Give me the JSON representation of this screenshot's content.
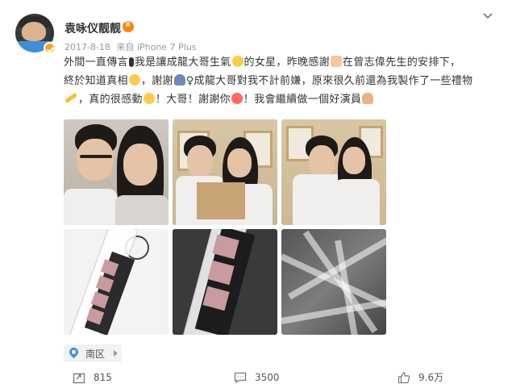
{
  "post": {
    "username": "袁咏仪靓靓",
    "date": "2017-8-18",
    "source": "来自 iPhone 7 Plus",
    "text": {
      "l1a": "外間一直傳言",
      "l1b": "我是讓成龍大哥生氣",
      "l1c": "的女星，昨晚感謝",
      "l1d": "在曾志偉先生的安排下，",
      "l2a": "終於知道真相",
      "l2b": "，謝謝",
      "l2c": "♀成龍大哥對我不計前嫌，原來很久前還為我製作了一些禮物",
      "l3a": "，真的很感動",
      "l3b": "！大哥！謝謝你",
      "l3c": "！我會繼續做一個好演員"
    },
    "location": "南区",
    "actions": {
      "repost_count": "815",
      "comment_count": "3500",
      "like_count": "9.6万"
    }
  },
  "icons": {
    "menu": "chevron-down-icon",
    "verified": "verified-badge-icon",
    "location": "location-pin-icon",
    "repost": "repost-icon",
    "comment": "comment-icon",
    "like": "thumbs-up-icon"
  },
  "colors": {
    "username": "#333333",
    "meta": "#999999",
    "location_pin": "#3a8ee6",
    "verified": "#f5a623"
  }
}
